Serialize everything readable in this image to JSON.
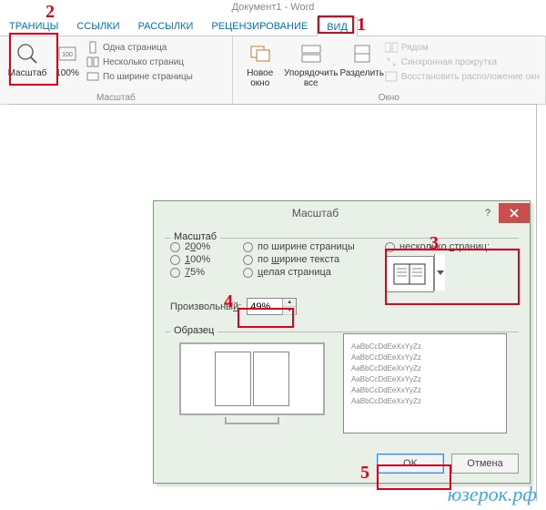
{
  "app_title": "Документ1 - Word",
  "ribbon_tabs": {
    "t0": "ТРАНИЦЫ",
    "t1": "ССЫЛКИ",
    "t2": "РАССЫЛКИ",
    "t3": "РЕЦЕНЗИРОВАНИЕ",
    "t4": "ВИД"
  },
  "zoom_group": {
    "zoom_btn": "Масштаб",
    "hundred": "100%",
    "one_page": "Одна страница",
    "multi_pages": "Несколько страниц",
    "page_width": "По ширине страницы",
    "group_label": "Масштаб"
  },
  "window_group": {
    "new_window": "Новое окно",
    "arrange_all": "Упорядочить все",
    "split": "Разделить",
    "side_by_side": "Рядом",
    "sync_scroll": "Синхронная прокрутка",
    "reset_pos": "Восстановить расположение окн",
    "group_label": "Окно"
  },
  "dialog": {
    "title": "Масштаб",
    "legend_zoom": "Масштаб",
    "r200": "200%",
    "r100": "100%",
    "r75": "75%",
    "r_page_width": "по ширине страницы",
    "r_text_width": "по ширине текста",
    "r_whole_page": "целая страница",
    "r_many_pages": "несколько страниц:",
    "custom_label": "Произвольный:",
    "custom_value": "49%",
    "legend_sample": "Образец",
    "sample_line": "AaBbCcDdEeXxYyZz",
    "ok": "OK",
    "cancel": "Отмена",
    "help": "?"
  },
  "annotations": {
    "n1": "1",
    "n2": "2",
    "n3": "3",
    "n4": "4",
    "n5": "5"
  },
  "watermark": "юзерок.рф"
}
